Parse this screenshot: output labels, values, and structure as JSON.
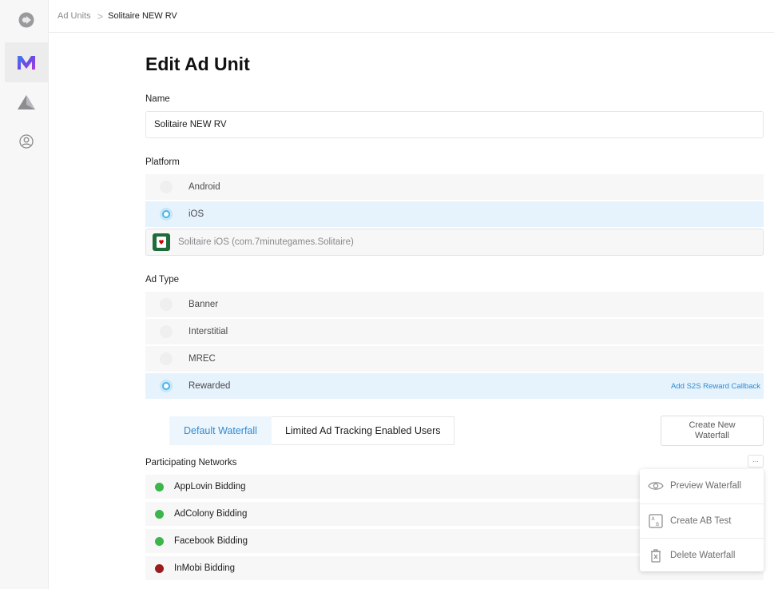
{
  "breadcrumb": {
    "parent": "Ad Units",
    "separator": ">",
    "current": "Solitaire NEW RV"
  },
  "sidebar": {
    "items": [
      {
        "icon": "app-logo-icon"
      },
      {
        "icon": "mediation-m-icon",
        "active": true
      },
      {
        "icon": "mountain-icon"
      },
      {
        "icon": "account-circle-icon"
      }
    ]
  },
  "page": {
    "title": "Edit Ad Unit"
  },
  "name_field": {
    "label": "Name",
    "value": "Solitaire NEW RV"
  },
  "platform": {
    "label": "Platform",
    "options": [
      {
        "label": "Android",
        "selected": false
      },
      {
        "label": "iOS",
        "selected": true
      }
    ],
    "app": {
      "name": "Solitaire iOS (com.7minutegames.Solitaire)",
      "icon": "solitaire-app-icon"
    }
  },
  "ad_type": {
    "label": "Ad Type",
    "options": [
      {
        "label": "Banner",
        "selected": false
      },
      {
        "label": "Interstitial",
        "selected": false
      },
      {
        "label": "MREC",
        "selected": false
      },
      {
        "label": "Rewarded",
        "selected": true
      }
    ],
    "reward_link": "Add S2S Reward Callback"
  },
  "waterfall": {
    "tabs": [
      {
        "label": "Default Waterfall",
        "active": true
      },
      {
        "label": "Limited Ad Tracking Enabled Users",
        "active": false
      }
    ],
    "create_button": {
      "line1": "Create New",
      "line2": "Waterfall"
    },
    "networks_label": "Participating Networks",
    "more_button": "...",
    "networks": [
      {
        "name": "AppLovin Bidding",
        "status_color": "#3cb54a"
      },
      {
        "name": "AdColony Bidding",
        "status_color": "#3cb54a"
      },
      {
        "name": "Facebook Bidding",
        "status_color": "#3cb54a"
      },
      {
        "name": "InMobi Bidding",
        "status_color": "#9b1c1c"
      }
    ],
    "menu": [
      {
        "label": "Preview Waterfall",
        "icon": "eye-icon"
      },
      {
        "label": "Create AB Test",
        "icon": "ab-test-icon"
      },
      {
        "label": "Delete Waterfall",
        "icon": "trash-icon"
      }
    ]
  },
  "colors": {
    "accent": "#2f8bd0",
    "radio_on": "#4ab3ec",
    "selected_bg": "#e6f2fc"
  }
}
